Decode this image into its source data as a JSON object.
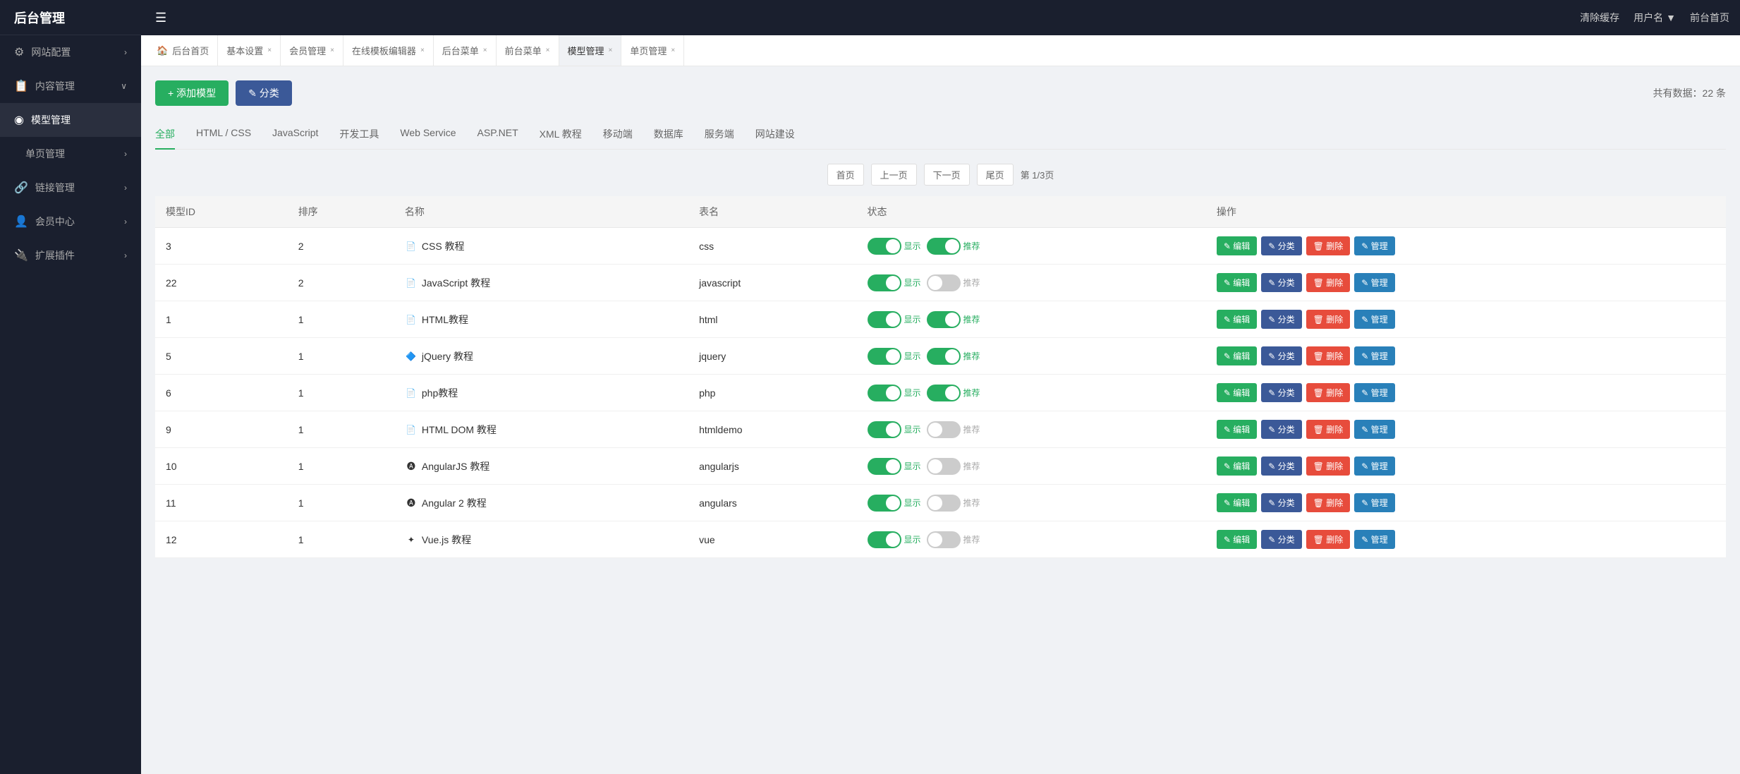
{
  "app": {
    "title": "后台管理"
  },
  "topbar": {
    "toggle_icon": "☰",
    "clear_cache": "清除缓存",
    "username": "用户名",
    "username_arrow": "▼",
    "frontend": "前台首页"
  },
  "sidebar": {
    "items": [
      {
        "id": "site-config",
        "icon": "⚙",
        "label": "网站配置",
        "arrow": "›",
        "active": false
      },
      {
        "id": "content-mgmt",
        "icon": "📋",
        "label": "内容管理",
        "arrow": "∨",
        "active": false
      },
      {
        "id": "model-mgmt",
        "icon": "◉",
        "label": "模型管理",
        "arrow": "",
        "active": true
      },
      {
        "id": "single-page",
        "icon": "",
        "label": "单页管理",
        "arrow": "›",
        "active": false
      },
      {
        "id": "link-mgmt",
        "icon": "🔗",
        "label": "链接管理",
        "arrow": "›",
        "active": false
      },
      {
        "id": "member-center",
        "icon": "👤",
        "label": "会员中心",
        "arrow": "›",
        "active": false
      },
      {
        "id": "extension",
        "icon": "🔌",
        "label": "扩展插件",
        "arrow": "›",
        "active": false
      }
    ]
  },
  "tabs": [
    {
      "id": "home",
      "label": "后台首页",
      "closable": false,
      "icon": "🏠"
    },
    {
      "id": "basic-settings",
      "label": "基本设置",
      "closable": true
    },
    {
      "id": "member-mgmt",
      "label": "会员管理",
      "closable": true
    },
    {
      "id": "template-editor",
      "label": "在线模板编辑器",
      "closable": true
    },
    {
      "id": "backend-menu",
      "label": "后台菜单",
      "closable": true
    },
    {
      "id": "frontend-menu",
      "label": "前台菜单",
      "closable": true
    },
    {
      "id": "model-mgmt-tab",
      "label": "模型管理",
      "closable": true,
      "active": true
    },
    {
      "id": "single-page-tab",
      "label": "单页管理",
      "closable": true
    }
  ],
  "toolbar": {
    "add_label": "+ 添加模型",
    "classify_label": "✎ 分类",
    "total_label": "共有数据：22 条"
  },
  "category_tabs": [
    {
      "id": "all",
      "label": "全部",
      "active": true
    },
    {
      "id": "html-css",
      "label": "HTML / CSS",
      "active": false
    },
    {
      "id": "javascript",
      "label": "JavaScript",
      "active": false
    },
    {
      "id": "dev-tools",
      "label": "开发工具",
      "active": false
    },
    {
      "id": "web-service",
      "label": "Web Service",
      "active": false
    },
    {
      "id": "asp-net",
      "label": "ASP.NET",
      "active": false
    },
    {
      "id": "xml",
      "label": "XML 教程",
      "active": false
    },
    {
      "id": "mobile",
      "label": "移动端",
      "active": false
    },
    {
      "id": "database",
      "label": "数据库",
      "active": false
    },
    {
      "id": "server",
      "label": "服务端",
      "active": false
    },
    {
      "id": "website",
      "label": "网站建设",
      "active": false
    }
  ],
  "pagination": {
    "first": "首页",
    "prev": "上一页",
    "next": "下一页",
    "last": "尾页",
    "current": "第 1/3页"
  },
  "table": {
    "headers": [
      "模型ID",
      "排序",
      "名称",
      "表名",
      "状态",
      "操作"
    ],
    "rows": [
      {
        "id": "3",
        "sort": "2",
        "name": "CSS 教程",
        "icon": "📄",
        "icon_color": "#27ae60",
        "table_name": "css",
        "show_on": true,
        "recommend_on": true
      },
      {
        "id": "22",
        "sort": "2",
        "name": "JavaScript 教程",
        "icon": "📄",
        "icon_color": "#888",
        "table_name": "javascript",
        "show_on": true,
        "recommend_on": false
      },
      {
        "id": "1",
        "sort": "1",
        "name": "HTML教程",
        "icon": "📄",
        "icon_color": "#888",
        "table_name": "html",
        "show_on": true,
        "recommend_on": true
      },
      {
        "id": "5",
        "sort": "1",
        "name": "jQuery 教程",
        "icon": "🔷",
        "icon_color": "#1565c0",
        "table_name": "jquery",
        "show_on": true,
        "recommend_on": true
      },
      {
        "id": "6",
        "sort": "1",
        "name": "php教程",
        "icon": "📄",
        "icon_color": "#888",
        "table_name": "php",
        "show_on": true,
        "recommend_on": true
      },
      {
        "id": "9",
        "sort": "1",
        "name": "HTML DOM 教程",
        "icon": "📄",
        "icon_color": "#888",
        "table_name": "htmldemo",
        "show_on": true,
        "recommend_on": false
      },
      {
        "id": "10",
        "sort": "1",
        "name": "AngularJS 教程",
        "icon": "🅐",
        "icon_color": "#e74c3c",
        "table_name": "angularjs",
        "show_on": true,
        "recommend_on": false
      },
      {
        "id": "11",
        "sort": "1",
        "name": "Angular 2 教程",
        "icon": "🅐",
        "icon_color": "#e74c3c",
        "table_name": "angulars",
        "show_on": true,
        "recommend_on": false
      },
      {
        "id": "12",
        "sort": "1",
        "name": "Vue.js 教程",
        "icon": "✦",
        "icon_color": "#27ae60",
        "table_name": "vue",
        "show_on": true,
        "recommend_on": false
      }
    ],
    "action_labels": {
      "edit": "✎ 编辑",
      "classify": "✎ 分类",
      "delete": "🗑 删除",
      "manage": "✎ 管理"
    },
    "toggle_labels": {
      "show": "显示",
      "recommend": "推荐"
    }
  }
}
